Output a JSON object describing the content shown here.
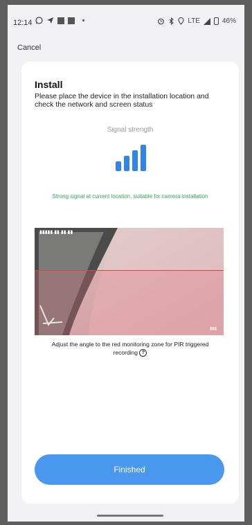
{
  "status_bar": {
    "time": "12:14",
    "network_label": "LTE",
    "battery": "46%"
  },
  "nav": {
    "cancel_label": "Cancel"
  },
  "install": {
    "title": "Install",
    "description": "Please place the device in the installation location and check the network and screen status",
    "signal_label": "Signal strength",
    "signal_bars": 4,
    "signal_status": "Strong signal at current location, suitable for camera installation",
    "angle_tip": "Adjust the angle to the red monitoring zone for PIR triggered recording",
    "finish_label": "Finished"
  },
  "colors": {
    "accent": "#4a97f0",
    "signal": "#2f85ea",
    "success": "#2eaa4a",
    "pir_zone": "#d4454d"
  }
}
